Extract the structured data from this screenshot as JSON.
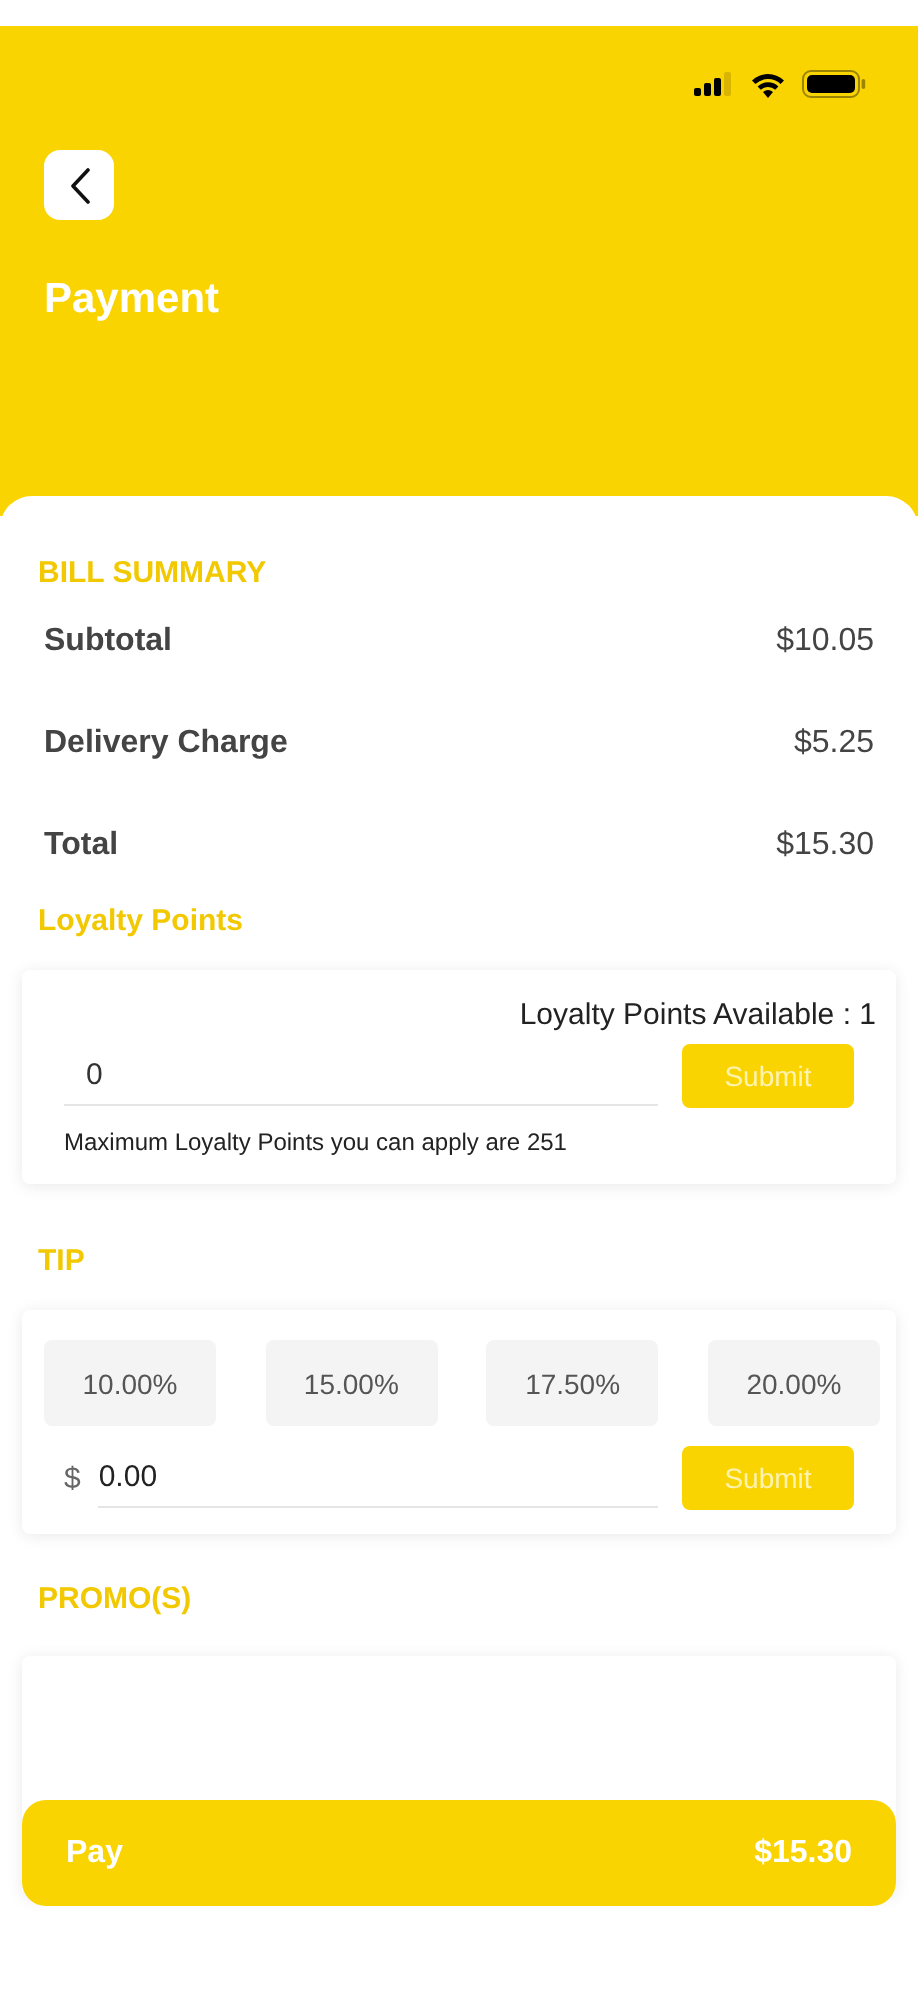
{
  "header": {
    "title": "Payment"
  },
  "bill_summary": {
    "heading": "BILL SUMMARY",
    "rows": [
      {
        "label": "Subtotal",
        "value": "$10.05"
      },
      {
        "label": "Delivery Charge",
        "value": "$5.25"
      },
      {
        "label": "Total",
        "value": "$15.30"
      }
    ]
  },
  "loyalty": {
    "heading": "Loyalty Points",
    "available": "Loyalty Points Available : 1",
    "value": "0",
    "button": "Submit",
    "note": "Maximum Loyalty Points you can apply are 251"
  },
  "tip": {
    "heading": "TIP",
    "options": [
      {
        "label": "10.00%",
        "selected": false
      },
      {
        "label": "15.00%",
        "selected": false
      },
      {
        "label": "17.50%",
        "selected": false
      },
      {
        "label": "20.00%",
        "selected": false
      }
    ],
    "currency": "$",
    "value": "0.00",
    "button": "Submit"
  },
  "promos": {
    "heading": "PROMO(S)"
  },
  "pay_bar": {
    "label": "Pay",
    "amount": "$15.30"
  }
}
